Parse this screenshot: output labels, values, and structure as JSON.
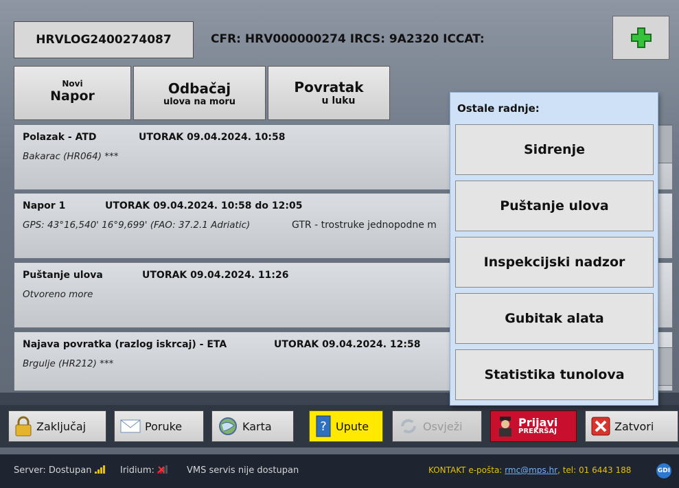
{
  "header": {
    "log_id": "HRVLOG2400274087",
    "ids_line": "CFR: HRV000000274  IRCS: 9A2320  ICCAT:",
    "add_button_icon": "green-plus-icon"
  },
  "actions": [
    {
      "line1": "Novi",
      "line2": "Napor"
    },
    {
      "line1": "Odbačaj",
      "line2": "ulova na moru"
    },
    {
      "line1": "Povratak",
      "line2": "u luku"
    }
  ],
  "events": [
    {
      "title": "Polazak - ATD",
      "time": "UTORAK 09.04.2024. 10:58",
      "sub": "Bakarac (HR064) ***",
      "sub2": ""
    },
    {
      "title": "Napor 1",
      "time": "UTORAK 09.04.2024. 10:58 do 12:05",
      "sub": "GPS: 43°16,540' 16°9,699' (FAO: 37.2.1 Adriatic)",
      "sub2": "GTR - trostruke jednopodne m"
    },
    {
      "title": "Puštanje ulova",
      "time": "UTORAK 09.04.2024. 11:26",
      "sub": "Otvoreno more",
      "sub2": ""
    },
    {
      "title": "Najava povratka (razlog iskrcaj) - ETA",
      "time": "UTORAK 09.04.2024. 12:58",
      "sub": "Brgulje (HR212) ***",
      "sub2": ""
    }
  ],
  "popup": {
    "title": "Ostale radnje:",
    "buttons": [
      "Sidrenje",
      "Puštanje ulova",
      "Inspekcijski nadzor",
      "Gubitak alata",
      "Statistika tunolova"
    ]
  },
  "toolbar": {
    "lock": "Zaključaj",
    "messages": "Poruke",
    "map": "Karta",
    "help": "Upute",
    "refresh": "Osvježi",
    "report_line1": "Prijavi",
    "report_line2": "PREKRŠAJ",
    "close": "Zatvori"
  },
  "status": {
    "server_label": "Server: Dostupan",
    "iridium_label": "Iridium:",
    "vms": "VMS servis nije dostupan",
    "kontakt_prefix": "KONTAKT e-pošta: ",
    "email": "rmc@mps.hr",
    "kontakt_suffix": ", tel: 01 6443 188",
    "badge": "GDI"
  },
  "colors": {
    "help_button": "#ffe900",
    "report_button": "#c8102e",
    "popup_bg": "#cfe1f7",
    "kontakt_text": "#e6c200"
  }
}
